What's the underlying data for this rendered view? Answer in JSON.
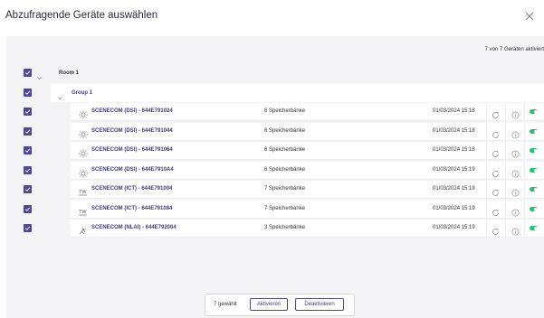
{
  "dialog": {
    "title": "Abzufragende Geräte auswählen",
    "close_icon": "close-icon"
  },
  "summary": {
    "activated_count": "7 von 7 Geräten aktiviert"
  },
  "tree": {
    "room": {
      "label": "Room 1",
      "checked": true,
      "expanded": true
    },
    "group": {
      "label": "Group 1",
      "checked": true,
      "expanded": true
    },
    "devices": [
      {
        "name": "SCENECOM (DSI) - 644E791024",
        "memory": "6 Speicherbänke",
        "date": "01/03/2024 15:18",
        "icon": "sun-dimmer-icon",
        "checked": true,
        "enabled": true
      },
      {
        "name": "SCENECOM (DSI) - 644E791044",
        "memory": "6 Speicherbänke",
        "date": "01/03/2024 15:18",
        "icon": "sun-dimmer-icon",
        "checked": true,
        "enabled": true
      },
      {
        "name": "SCENECOM (DSI) - 644E791064",
        "memory": "6 Speicherbänke",
        "date": "01/03/2024 15:18",
        "icon": "sun-dimmer-icon",
        "checked": true,
        "enabled": true
      },
      {
        "name": "SCENECOM (DSI) - 644E7910A4",
        "memory": "6 Speicherbänke",
        "date": "01/03/2024 15:19",
        "icon": "sun-dimmer-icon",
        "checked": true,
        "enabled": true
      },
      {
        "name": "SCENECOM (ICT) - 644E791004",
        "memory": "7 Speicherbänke",
        "date": "01/03/2024 15:19",
        "icon": "tw-icon",
        "checked": true,
        "enabled": true
      },
      {
        "name": "SCENECOM (ICT) - 644E791084",
        "memory": "7 Speicherbänke",
        "date": "01/03/2024 15:19",
        "icon": "tw-icon",
        "checked": true,
        "enabled": true
      },
      {
        "name": "SCENECOM (NLAI) - 644E792004",
        "memory": "3 Speicherbänke",
        "date": "01/03/2024 15:19",
        "icon": "lamp-icon",
        "checked": true,
        "enabled": true
      }
    ]
  },
  "footer": {
    "selected_count": "7 gewählt",
    "activate_label": "Aktivieren",
    "deactivate_label": "Deaktivieren"
  },
  "icons": {
    "tw_text": "TW"
  },
  "colors": {
    "accent": "#4f4993",
    "toggle_on": "#1ec86a",
    "panel_bg": "#f4f4f7"
  }
}
